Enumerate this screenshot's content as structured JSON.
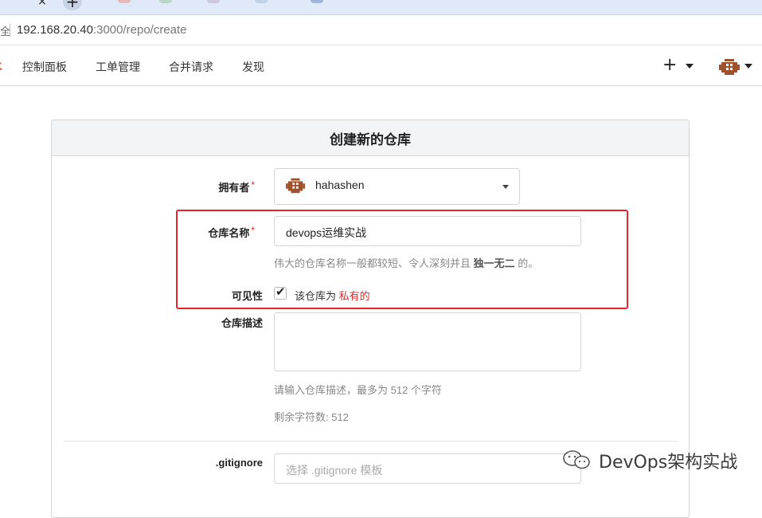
{
  "browser": {
    "url_host": "192.168.20.40",
    "url_path": ":3000/repo/create",
    "lock_glyph": "全",
    "tab_close": "×",
    "new_tab": "+"
  },
  "nav": {
    "items": [
      "控制面板",
      "工单管理",
      "合并请求",
      "发现"
    ],
    "plus": "+"
  },
  "form": {
    "title": "创建新的仓库",
    "owner_label": "拥有者",
    "required_mark": "*",
    "owner_value": "hahashen",
    "repo_name_label": "仓库名称",
    "repo_name_value": "devops运维实战",
    "repo_name_help_prefix": "伟大的仓库名称一般都较短、令人深刻并且",
    "repo_name_help_bold": "独一无二",
    "repo_name_help_suffix": "的。",
    "visibility_label": "可见性",
    "visibility_checked": true,
    "visibility_text": "该仓库为",
    "visibility_private": "私有的",
    "description_label": "仓库描述",
    "description_value": "",
    "description_help": "请输入仓库描述，最多为 512 个字符",
    "remaining_label": "剩余字符数: 512",
    "gitignore_label": ".gitignore",
    "gitignore_placeholder": "选择 .gitignore 模板"
  },
  "watermark": "DevOps架构实战",
  "colors": {
    "required": "#db2828",
    "highlight_box": "#e8242c",
    "header_bg": "#f3f4f5",
    "avatar": "#a0522d"
  }
}
